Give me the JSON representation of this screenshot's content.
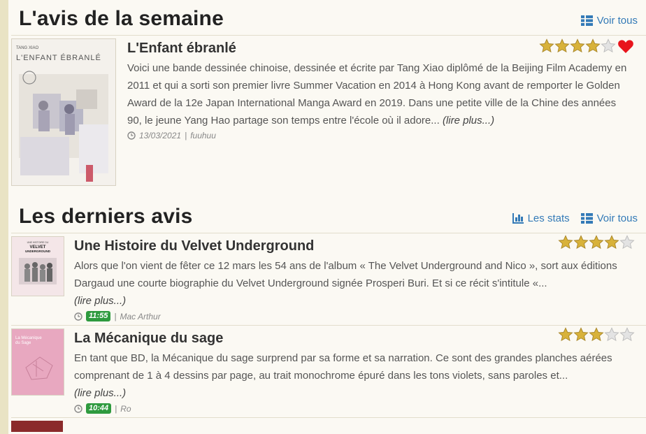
{
  "week": {
    "title": "L'avis de la semaine",
    "see_all": "Voir tous",
    "item": {
      "title": "L'Enfant ébranlé",
      "text": "Voici une bande dessinée chinoise, dessinée et écrite par Tang Xiao diplômé de la Beijing Film Academy en 2011 et qui a sorti son premier livre Summer Vacation en 2014 à Hong Kong avant de remporter le Golden Award de la 12e Japan International Manga Award en 2019. Dans une petite ville de la Chine des années 90, le jeune Yang Hao partage son temps entre l'école où il adore...",
      "read_more": "(lire plus...)",
      "date": "13/03/2021",
      "separator": "|",
      "author": "fuuhuu",
      "rating": 4,
      "max_rating": 5,
      "cover_author": "TANG XIAO",
      "cover_title": "L'ENFANT ÉBRANLÉ"
    }
  },
  "latest": {
    "title": "Les derniers avis",
    "stats": "Les stats",
    "see_all": "Voir tous",
    "items": [
      {
        "title": "Une Histoire du Velvet Underground",
        "text": "Alors que l'on vient de fêter ce 12 mars les 54 ans de l'album « The Velvet Underground and Nico », sort aux éditions Dargaud une courte biographie du Velvet Underground signée Prosperi Buri. Et si ce récit s'intitule «...",
        "read_more": "(lire plus...)",
        "time": "11:55",
        "separator": "|",
        "author": "Mac Arthur",
        "rating": 4,
        "max_rating": 5,
        "cover_line1": "UNE HISTOIRE DU",
        "cover_line2": "VELVET",
        "cover_line3": "UNDERGROUND"
      },
      {
        "title": "La Mécanique du sage",
        "text": "En tant que BD, la Mécanique du sage surprend par sa forme et sa narration. Ce sont des grandes planches aérées comprenant de 1 à 4 dessins par page, au trait monochrome épuré dans les tons violets, sans paroles et...",
        "read_more": "(lire plus...)",
        "time": "10:44",
        "separator": "|",
        "author": "Ro",
        "rating": 3,
        "max_rating": 5,
        "cover_line1": "La Mécanique",
        "cover_line2": "du Sage"
      }
    ]
  },
  "colors": {
    "link": "#337ab7",
    "star_filled": "#d8b23a",
    "star_empty": "#e3e3e3",
    "heart": "#e8141c",
    "time_badge": "#2e9a3e"
  },
  "icons": {
    "list": "list-icon",
    "stats": "bar-chart-icon",
    "clock": "clock-icon",
    "star": "star-icon",
    "heart": "heart-icon"
  }
}
